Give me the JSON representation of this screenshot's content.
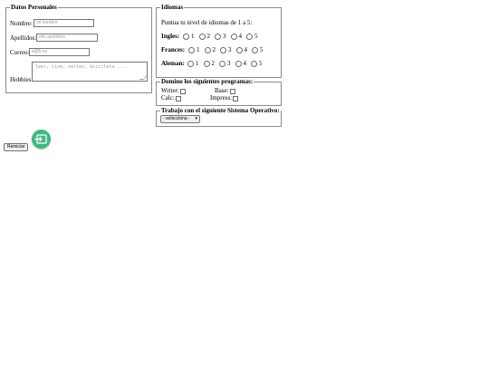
{
  "personal": {
    "legend": "Datos Personales",
    "nombre_label": "Nombre:",
    "nombre_placeholder": "mi nombre",
    "apellidos_label": "Apellidos:",
    "apellidos_placeholder": "mis apellidos",
    "correo_label": "Correo:",
    "correo_placeholder": "a@b.es",
    "hobbies_label": "Hobbies:",
    "hobbies_placeholder": "leer, cine, series, bicicleta ..."
  },
  "idiomas": {
    "legend": "Idiomas",
    "intro": "Puntua tu nivel de idiomas de 1 a 5:",
    "languages": [
      {
        "label": "Ingles:"
      },
      {
        "label": "Frances:"
      },
      {
        "label": "Aleman:"
      }
    ],
    "levels": [
      "1",
      "2",
      "3",
      "4",
      "5"
    ]
  },
  "programas": {
    "legend": "Domino los siguientes programas:",
    "items": [
      {
        "label": "Writer:"
      },
      {
        "label": "Base:"
      },
      {
        "label": "Calc:"
      },
      {
        "label": "Impress:"
      }
    ]
  },
  "so": {
    "legend": "Trabajo con el siguiente Sistema Operativo:",
    "selected": "- selecciona -"
  },
  "actions": {
    "reset_label": "Reiniciar",
    "fab_color": "#3fb97c",
    "fab_icon": "input-icon"
  }
}
